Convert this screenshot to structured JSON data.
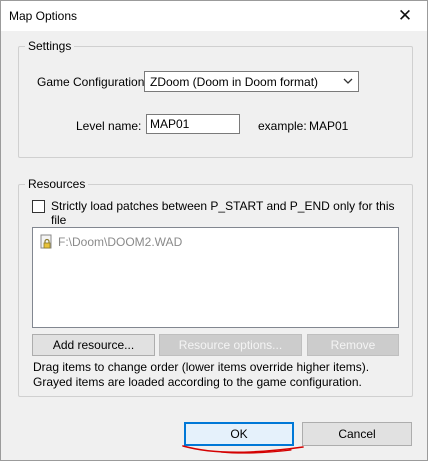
{
  "window": {
    "title": "Map Options",
    "close_glyph": "✕"
  },
  "settings": {
    "legend": "Settings",
    "game_config_label": "Game Configuration:",
    "game_config_value": "ZDoom (Doom in Doom format)",
    "level_name_label": "Level name:",
    "level_name_value": "MAP01",
    "example_label": "example:",
    "example_value": "MAP01"
  },
  "resources": {
    "legend": "Resources",
    "strict_patches_label": "Strictly load patches between P_START and P_END only for this file",
    "strict_patches_checked": false,
    "items": [
      {
        "path": "F:\\Doom\\DOOM2.WAD",
        "icon": "locked-file-icon",
        "grayed": true
      }
    ],
    "add_label": "Add resource...",
    "options_label": "Resource options...",
    "remove_label": "Remove",
    "hint_line1": "Drag items to change order (lower items override higher items).",
    "hint_line2": "Grayed items are loaded according to the game configuration."
  },
  "footer": {
    "ok_label": "OK",
    "cancel_label": "Cancel"
  },
  "colors": {
    "accent": "#0078d7",
    "annotation": "#d40000"
  }
}
